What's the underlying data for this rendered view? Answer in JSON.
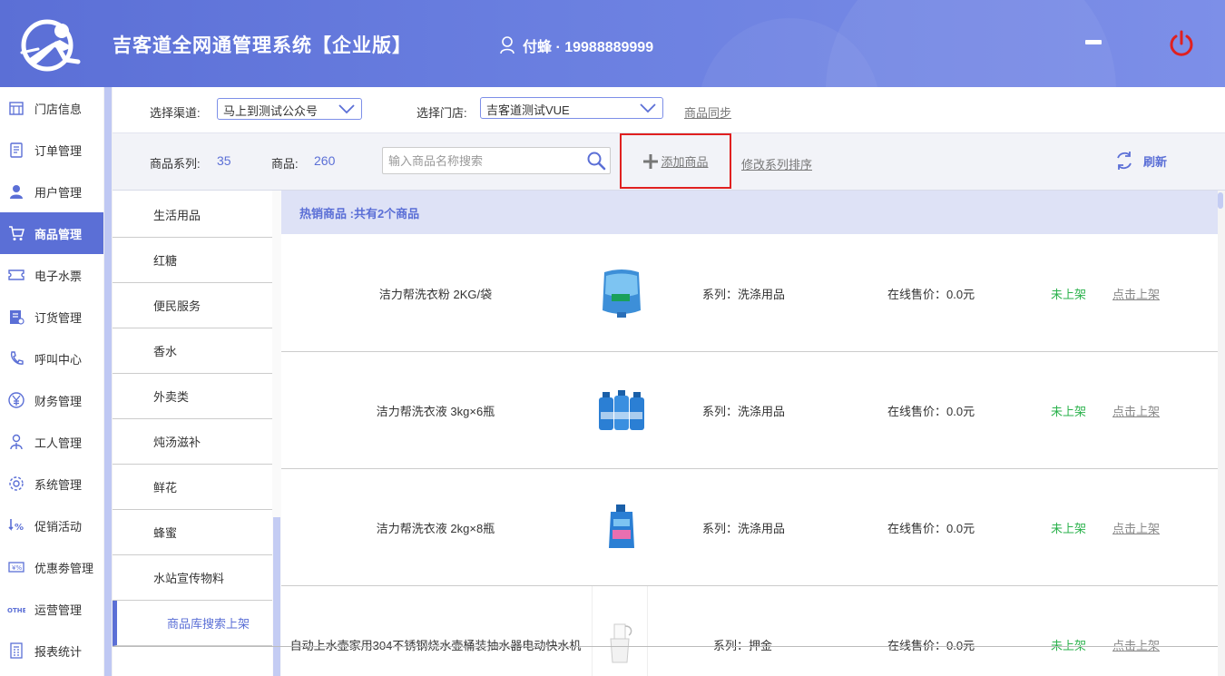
{
  "header": {
    "title": "吉客道全网通管理系统【企业版】",
    "user": "付蜂 · 19988889999"
  },
  "sidebar": {
    "items": [
      {
        "label": "门店信息",
        "icon": "store-icon"
      },
      {
        "label": "订单管理",
        "icon": "order-icon"
      },
      {
        "label": "用户管理",
        "icon": "user-icon"
      },
      {
        "label": "商品管理",
        "icon": "cart-icon",
        "active": true
      },
      {
        "label": "电子水票",
        "icon": "ticket-icon"
      },
      {
        "label": "订货管理",
        "icon": "order-goods-icon"
      },
      {
        "label": "呼叫中心",
        "icon": "phone-icon"
      },
      {
        "label": "财务管理",
        "icon": "yen-icon"
      },
      {
        "label": "工人管理",
        "icon": "worker-icon"
      },
      {
        "label": "系统管理",
        "icon": "gear-icon"
      },
      {
        "label": "促销活动",
        "icon": "percent-icon"
      },
      {
        "label": "优惠劵管理",
        "icon": "coupon-icon"
      },
      {
        "label": "运营管理",
        "icon": "other-icon"
      },
      {
        "label": "报表统计",
        "icon": "report-icon"
      }
    ]
  },
  "filter": {
    "channel_label": "选择渠道:",
    "channel_value": "马上到测试公众号",
    "store_label": "选择门店:",
    "store_value": "吉客道测试VUE",
    "sync_label": "商品同步"
  },
  "toolbar": {
    "series_label": "商品系列:",
    "series_count": "35",
    "goods_label": "商品:",
    "goods_count": "260",
    "search_placeholder": "输入商品名称搜索",
    "add_label": "添加商品",
    "reorder_label": "修改系列排序",
    "refresh_label": "刷新"
  },
  "categories": [
    "生活用品",
    "红糖",
    "便民服务",
    "香水",
    "外卖类",
    "炖汤滋补",
    "鲜花",
    "蜂蜜",
    "水站宣传物料",
    "商品库搜索上架"
  ],
  "products": {
    "group_title": "热销商品 :共有2个商品",
    "items": [
      {
        "name": "洁力帮洗衣粉 2KG/袋",
        "series": "系列：洗涤用品",
        "price": "在线售价：0.0元",
        "status": "未上架",
        "action": "点击上架",
        "img": "detergent-bag"
      },
      {
        "name": "洁力帮洗衣液 3kg×6瓶",
        "series": "系列：洗涤用品",
        "price": "在线售价：0.0元",
        "status": "未上架",
        "action": "点击上架",
        "img": "bottles"
      },
      {
        "name": "洁力帮洗衣液 2kg×8瓶",
        "series": "系列：洗涤用品",
        "price": "在线售价：0.0元",
        "status": "未上架",
        "action": "点击上架",
        "img": "bottle"
      },
      {
        "name": "自动上水壶家用304不锈钢烧水壶桶装抽水器电动快水机",
        "series": "系列：押金",
        "price": "在线售价：0.0元",
        "status": "未上架",
        "action": "点击上架",
        "img": "kettle"
      }
    ]
  },
  "colors": {
    "primary": "#5b6fd6",
    "header_light": "#7d8fe8",
    "status_green": "#2bb24c",
    "highlight_red": "#e02020",
    "power_red": "#e02020"
  }
}
